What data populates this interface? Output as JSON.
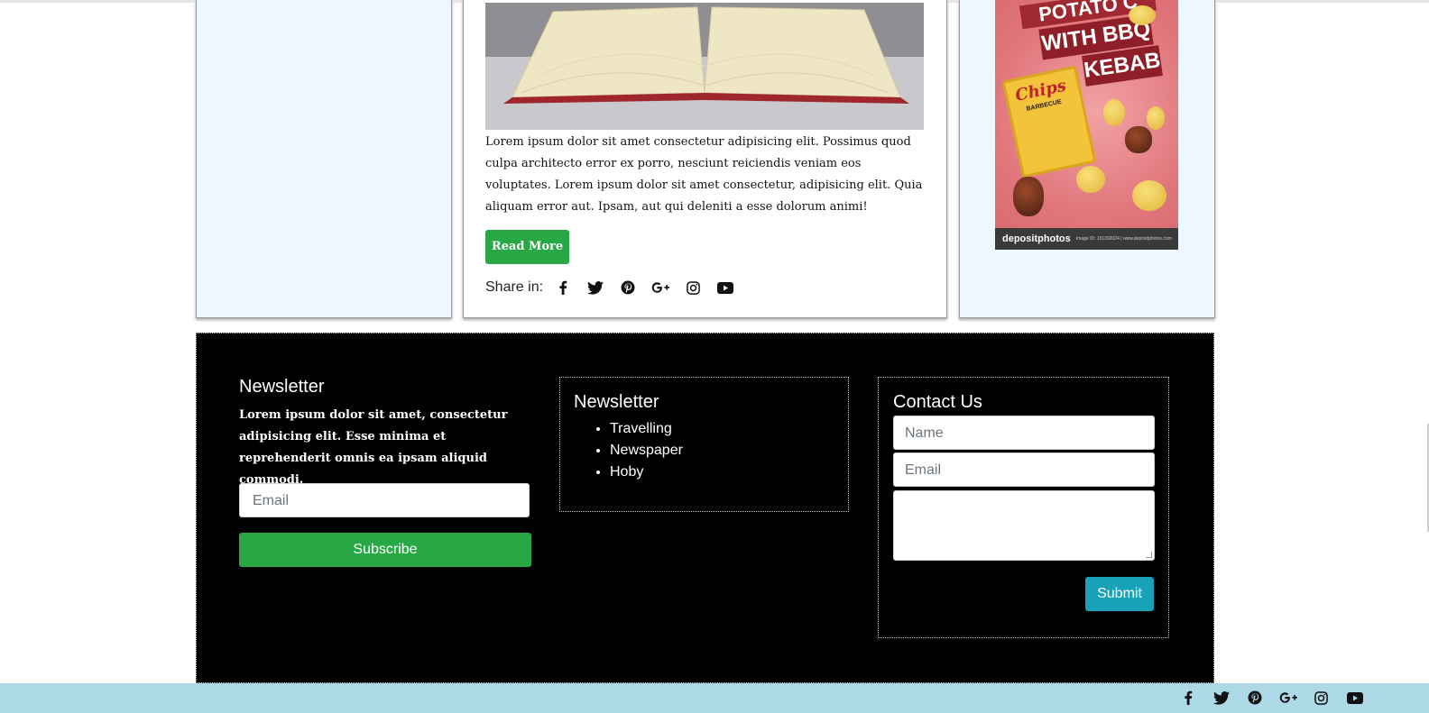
{
  "article": {
    "body": "Lorem ipsum dolor sit amet consectetur adipisicing elit. Possimus quod culpa architecto error ex porro, nesciunt reiciendis veniam eos voluptates. Lorem ipsum dolor sit amet consectetur, adipisicing elit. Quia aliquam error aut. Ipsam, aut qui deleniti a esse dolorum animi!",
    "read_more_label": "Read More",
    "share_label": "Share in:",
    "share_icons": [
      "facebook-icon",
      "twitter-icon",
      "pinterest-icon",
      "google-plus-icon",
      "instagram-icon",
      "youtube-icon"
    ]
  },
  "ad": {
    "line1": "POTATO C",
    "line2": "WITH BBQ",
    "line3": "KEBAB",
    "bag_brand": "Chips",
    "bag_sub": "BARBECUE",
    "footer_brand": "depositphotos",
    "footer_small": "Image ID: 151392024 | www.depositphotos.com"
  },
  "footer": {
    "newsletter": {
      "title": "Newsletter",
      "description": "Lorem ipsum dolor sit amet, consectetur adipisicing elit. Esse minima et reprehenderit omnis ea ipsam aliquid commodi.",
      "email_placeholder": "Email",
      "subscribe_label": "Subscribe"
    },
    "links": {
      "title": "Newsletter",
      "items": [
        "Travelling",
        "Newspaper",
        "Hoby"
      ]
    },
    "contact": {
      "title": "Contact Us",
      "name_placeholder": "Name",
      "email_placeholder": "Email",
      "submit_label": "Submit"
    }
  },
  "bottom_bar": {
    "icons": [
      "facebook-icon",
      "twitter-icon",
      "pinterest-icon",
      "google-plus-icon",
      "instagram-icon",
      "youtube-icon"
    ]
  },
  "colors": {
    "green": "#28a745",
    "teal": "#17a2b8",
    "panel": "#eef6ff",
    "bottom_bar": "#add8e6"
  }
}
